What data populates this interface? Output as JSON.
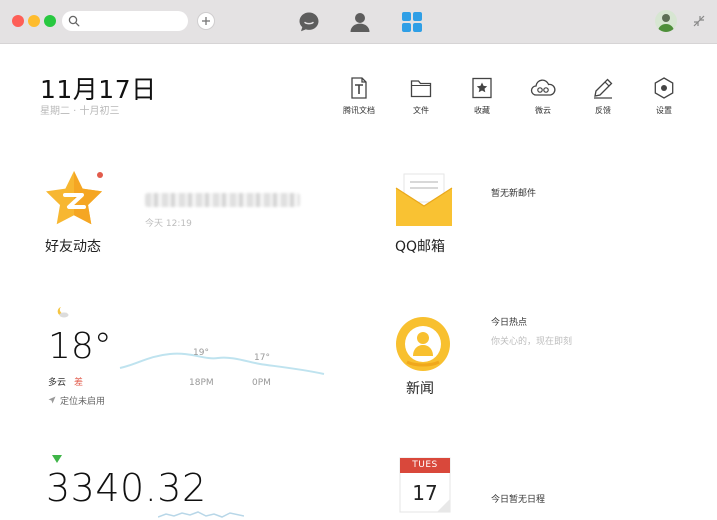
{
  "titlebar": {
    "search": {
      "placeholder": ""
    },
    "nav": [
      "chat-icon",
      "contacts-icon",
      "apps-grid-icon"
    ],
    "accent": "#2f9fe6"
  },
  "date": {
    "main": "11月17日",
    "sub": "星期二 · 十月初三"
  },
  "tools": [
    {
      "icon": "tencent-docs-icon",
      "label": "腾讯文档"
    },
    {
      "icon": "folder-icon",
      "label": "文件"
    },
    {
      "icon": "favorites-icon",
      "label": "收藏"
    },
    {
      "icon": "cloud-icon",
      "label": "微云"
    },
    {
      "icon": "feedback-pen-icon",
      "label": "反馈"
    },
    {
      "icon": "settings-icon",
      "label": "设置"
    }
  ],
  "friends": {
    "title": "好友动态",
    "time": "今天 12:19",
    "badge_color": "#e25b4b"
  },
  "mail": {
    "title": "QQ邮箱",
    "status": "暂无新邮件"
  },
  "weather": {
    "temp": "18°",
    "condition": "多云",
    "air": "差",
    "location": "定位未启用",
    "forecast": [
      {
        "temp": "19°",
        "time": "18PM"
      },
      {
        "temp": "17°",
        "time": "0PM"
      }
    ]
  },
  "news": {
    "title": "新闻",
    "headline": "今日热点",
    "sub": "你关心的，现在即刻"
  },
  "stock": {
    "value": "3340.32",
    "trend_color": "#3fb548"
  },
  "calendar": {
    "day_label": "TUES",
    "day_num": "17",
    "status": "今日暂无日程"
  }
}
